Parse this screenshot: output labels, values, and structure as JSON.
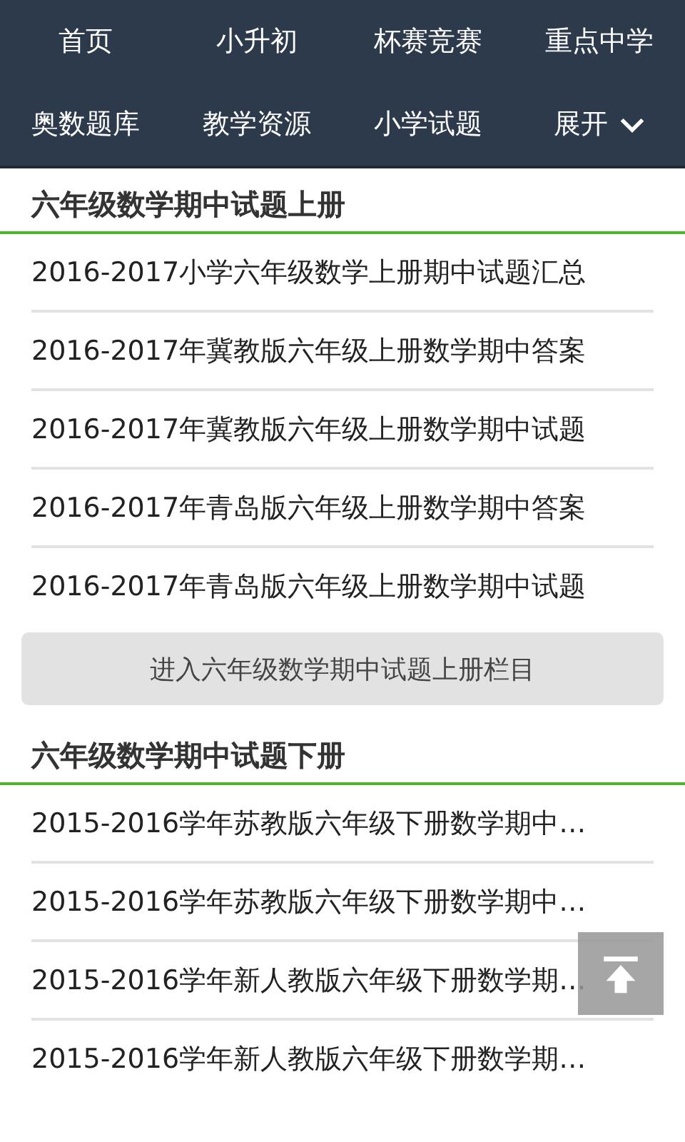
{
  "nav": {
    "items": [
      {
        "label": "首页"
      },
      {
        "label": "小升初"
      },
      {
        "label": "杯赛竞赛"
      },
      {
        "label": "重点中学"
      },
      {
        "label": "奥数题库"
      },
      {
        "label": "教学资源"
      },
      {
        "label": "小学试题"
      },
      {
        "label": "展开",
        "kind": "expand"
      }
    ]
  },
  "sections": [
    {
      "title": "六年级数学期中试题上册",
      "items": [
        "2016-2017小学六年级数学上册期中试题汇总",
        "2016-2017年冀教版六年级上册数学期中答案",
        "2016-2017年冀教版六年级上册数学期中试题",
        "2016-2017年青岛版六年级上册数学期中答案",
        "2016-2017年青岛版六年级上册数学期中试题"
      ],
      "more_button": "进入六年级数学期中试题上册栏目"
    },
    {
      "title": "六年级数学期中试题下册",
      "items": [
        "2015-2016学年苏教版六年级下册数学期中…",
        "2015-2016学年苏教版六年级下册数学期中…",
        "2015-2016学年新人教版六年级下册数学期…",
        "2015-2016学年新人教版六年级下册数学期…"
      ]
    }
  ]
}
